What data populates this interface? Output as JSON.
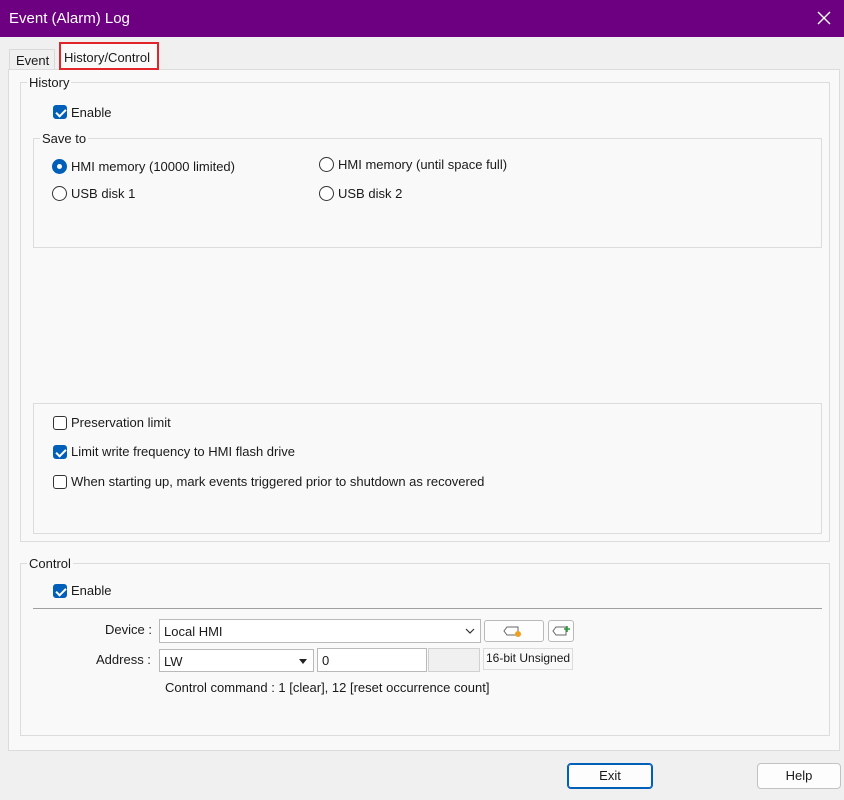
{
  "window": {
    "title": "Event (Alarm) Log"
  },
  "tabs": {
    "event": "Event",
    "history_control": "History/Control"
  },
  "history": {
    "group_label": "History",
    "enable_label": "Enable",
    "enable_checked": true,
    "save_to": {
      "group_label": "Save to",
      "options": [
        {
          "label": "HMI memory (10000 limited)",
          "selected": true
        },
        {
          "label": "HMI memory (until space full)",
          "selected": false
        },
        {
          "label": "USB disk 1",
          "selected": false
        },
        {
          "label": "USB disk 2",
          "selected": false
        }
      ]
    },
    "options": [
      {
        "label": "Preservation limit",
        "checked": false
      },
      {
        "label": "Limit write frequency to HMI flash drive",
        "checked": true
      },
      {
        "label": "When starting up, mark events triggered prior to shutdown as recovered",
        "checked": false
      }
    ]
  },
  "control": {
    "group_label": "Control",
    "enable_label": "Enable",
    "enable_checked": true,
    "device_label": "Device :",
    "device_value": "Local HMI",
    "address_label": "Address :",
    "address_type": "LW",
    "address_value": "0",
    "data_format": "16-bit Unsigned",
    "command_text": "Control command : 1 [clear], 12 [reset occurrence count]"
  },
  "buttons": {
    "exit": "Exit",
    "help": "Help"
  },
  "colors": {
    "title_bar": "#6c0080",
    "accent": "#005fb8",
    "tab_highlight": "#e0262a"
  },
  "icons": [
    "close-icon",
    "tag-settings-icon",
    "add-tag-icon",
    "dropdown-arrow-icon"
  ]
}
